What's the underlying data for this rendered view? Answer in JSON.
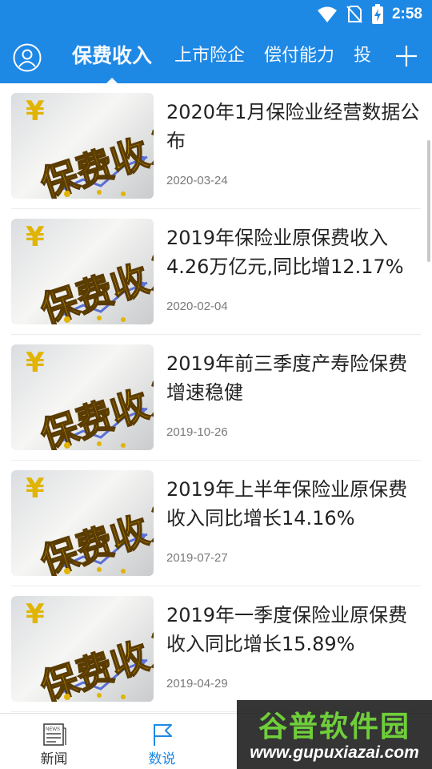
{
  "status_bar": {
    "time": "2:58"
  },
  "header": {
    "tabs": [
      {
        "label": "保费收入",
        "active": true
      },
      {
        "label": "上市险企",
        "active": false
      },
      {
        "label": "偿付能力",
        "active": false
      },
      {
        "label": "投",
        "active": false
      }
    ]
  },
  "articles": [
    {
      "title": "2020年1月保险业经营数据公布",
      "date": "2020-03-24",
      "thumb_text": "保费收入"
    },
    {
      "title": "2019年保险业原保费收入4.26万亿元,同比增12.17%",
      "date": "2020-02-04",
      "thumb_text": "保费收入"
    },
    {
      "title": "2019年前三季度产寿险保费增速稳健",
      "date": "2019-10-26",
      "thumb_text": "保费收入"
    },
    {
      "title": "2019年上半年保险业原保费收入同比增长14.16%",
      "date": "2019-07-27",
      "thumb_text": "保费收入"
    },
    {
      "title": "2019年一季度保险业原保费收入同比增长15.89%",
      "date": "2019-04-29",
      "thumb_text": "保费收入"
    }
  ],
  "bottom_nav": {
    "items": [
      {
        "label": "新闻",
        "icon": "newspaper-icon",
        "active": false
      },
      {
        "label": "数说",
        "icon": "flag-icon",
        "active": true
      }
    ]
  },
  "watermark": {
    "title": "谷普软件园",
    "url": "www.gupuxiazai.com"
  },
  "colors": {
    "primary": "#1e88e5",
    "text": "#222222",
    "date": "#7a7a7a",
    "watermark_green": "#6fcf3a"
  }
}
